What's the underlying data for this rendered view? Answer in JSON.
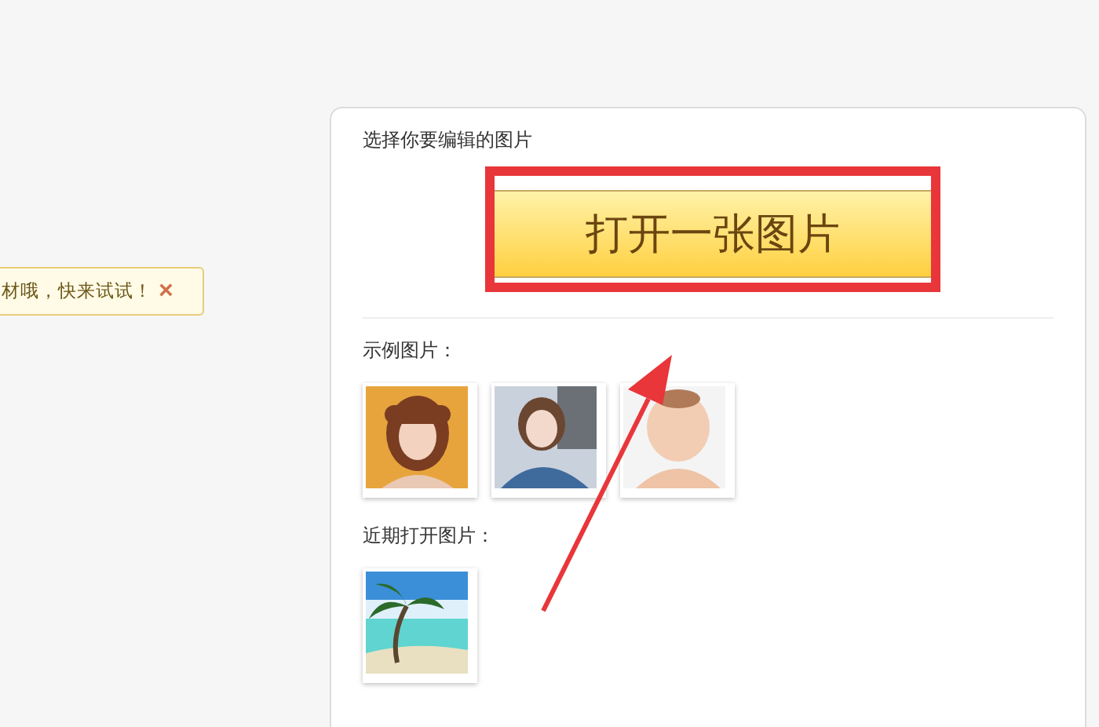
{
  "tip": {
    "text": "材哦，快来试试！",
    "close": "×"
  },
  "card": {
    "title": "选择你要编辑的图片",
    "open_button": "打开一张图片",
    "examples_label": "示例图片：",
    "recent_label": "近期打开图片："
  }
}
